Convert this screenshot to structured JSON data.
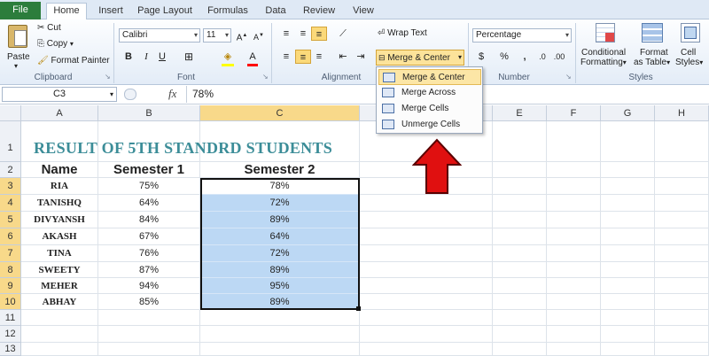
{
  "tabs": [
    "File",
    "Home",
    "Insert",
    "Page Layout",
    "Formulas",
    "Data",
    "Review",
    "View"
  ],
  "clipboard": {
    "paste": "Paste",
    "cut": "Cut",
    "copy": "Copy",
    "format_painter": "Format Painter",
    "label": "Clipboard"
  },
  "font": {
    "name": "Calibri",
    "size": "11",
    "bold": "B",
    "italic": "I",
    "underline": "U",
    "label": "Font"
  },
  "alignment": {
    "wrap_text": "Wrap Text",
    "merge_center": "Merge & Center",
    "label": "Alignment"
  },
  "number": {
    "format": "Percentage",
    "currency": "$",
    "percent": "%",
    "comma": ",",
    "label": "Number"
  },
  "styles": {
    "conditional": "Conditional",
    "formatting": "Formatting",
    "format": "Format",
    "as_table": "as Table",
    "cell": "Cell",
    "cell_styles": "Styles",
    "label": "Styles"
  },
  "formula_bar": {
    "name_box": "C3",
    "fx": "fx",
    "value": "78%"
  },
  "merge_menu": [
    "Merge & Center",
    "Merge Across",
    "Merge Cells",
    "Unmerge Cells"
  ],
  "columns": [
    "A",
    "B",
    "C",
    "D",
    "E",
    "F",
    "G",
    "H"
  ],
  "rows": [
    "1",
    "2",
    "3",
    "4",
    "5",
    "6",
    "7",
    "8",
    "9",
    "10",
    "11",
    "12",
    "13"
  ],
  "sheet": {
    "title": "RESULT OF 5TH STANDRD STUDENTS",
    "headers": [
      "Name",
      "Semester 1",
      "Semester 2"
    ],
    "data": [
      [
        "RIA",
        "75%",
        "78%"
      ],
      [
        "TANISHQ",
        "64%",
        "72%"
      ],
      [
        "DIVYANSH",
        "84%",
        "89%"
      ],
      [
        "AKASH",
        "67%",
        "64%"
      ],
      [
        "TINA",
        "76%",
        "72%"
      ],
      [
        "SWEETY",
        "87%",
        "89%"
      ],
      [
        "MEHER",
        "94%",
        "95%"
      ],
      [
        "ABHAY",
        "85%",
        "89%"
      ]
    ]
  },
  "colors": {
    "file_tab": "#2c7d3c",
    "title": "#3c8d98",
    "selection": "#bcd8f4",
    "arrow": "#e01010"
  }
}
